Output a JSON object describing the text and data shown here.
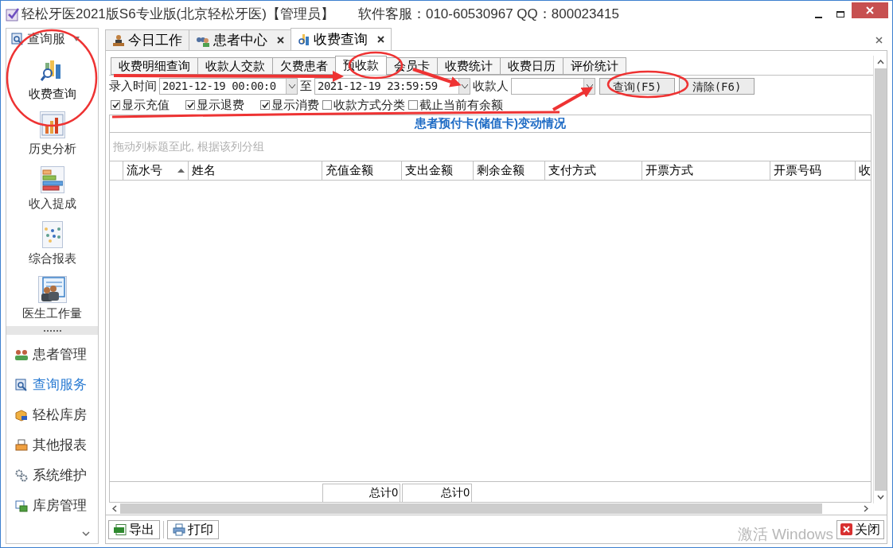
{
  "window": {
    "title": "轻松牙医2021版S6专业版(北京轻松牙医)【管理员】",
    "support": "软件客服：010-60530967 QQ：800023415"
  },
  "sidebar": {
    "header": "查询服",
    "tools": [
      {
        "label": "收费查询",
        "selected": true
      },
      {
        "label": "历史分析",
        "selected": false
      },
      {
        "label": "收入提成",
        "selected": false
      },
      {
        "label": "综合报表",
        "selected": false
      },
      {
        "label": "医生工作量",
        "selected": false
      }
    ],
    "items": [
      {
        "label": "患者管理",
        "selected": false
      },
      {
        "label": "查询服务",
        "selected": true
      },
      {
        "label": "轻松库房",
        "selected": false
      },
      {
        "label": "其他报表",
        "selected": false
      },
      {
        "label": "系统维护",
        "selected": false
      },
      {
        "label": "库房管理",
        "selected": false
      }
    ]
  },
  "tabs": [
    {
      "label": "今日工作",
      "selected": false,
      "closable": false
    },
    {
      "label": "患者中心",
      "selected": false,
      "closable": true
    },
    {
      "label": "收费查询",
      "selected": true,
      "closable": true
    }
  ],
  "subtabs": [
    {
      "label": "收费明细查询",
      "selected": false
    },
    {
      "label": "收款人交款",
      "selected": false
    },
    {
      "label": "欠费患者",
      "selected": false
    },
    {
      "label": "预收款",
      "selected": true
    },
    {
      "label": "会员卡",
      "selected": false
    },
    {
      "label": "收费统计",
      "selected": false
    },
    {
      "label": "收费日历",
      "selected": false
    },
    {
      "label": "评价统计",
      "selected": false
    }
  ],
  "filter": {
    "time_label": "录入时间",
    "start": "2021-12-19 00:00:0",
    "to_label": "至",
    "end": "2021-12-19 23:59:59",
    "payee_label": "收款人",
    "query_button": "查询(F5)",
    "clear_button": "清除(F6)"
  },
  "options": [
    {
      "label": "显示充值",
      "checked": true
    },
    {
      "label": "显示退费",
      "checked": true
    },
    {
      "label": "显示消费",
      "checked": true
    },
    {
      "label": "收款方式分类",
      "checked": false
    },
    {
      "label": "截止当前有余额",
      "checked": false
    }
  ],
  "report_title": "患者预付卡(储值卡)变动情况",
  "group_hint": "拖动列标题至此, 根据该列分组",
  "columns": [
    {
      "label": "流水号",
      "sorted": true
    },
    {
      "label": "姓名",
      "sorted": false
    },
    {
      "label": "充值金额",
      "sorted": false,
      "total": "总计0"
    },
    {
      "label": "支出金额",
      "sorted": false,
      "total": "总计0"
    },
    {
      "label": "剩余金额",
      "sorted": false
    },
    {
      "label": "支付方式",
      "sorted": false
    },
    {
      "label": "开票方式",
      "sorted": false
    },
    {
      "label": "开票号码",
      "sorted": false
    },
    {
      "label": "收",
      "sorted": false
    }
  ],
  "buttons": {
    "export": "导出",
    "print": "打印",
    "close": "关闭"
  },
  "os_notice": "激活 Windows"
}
